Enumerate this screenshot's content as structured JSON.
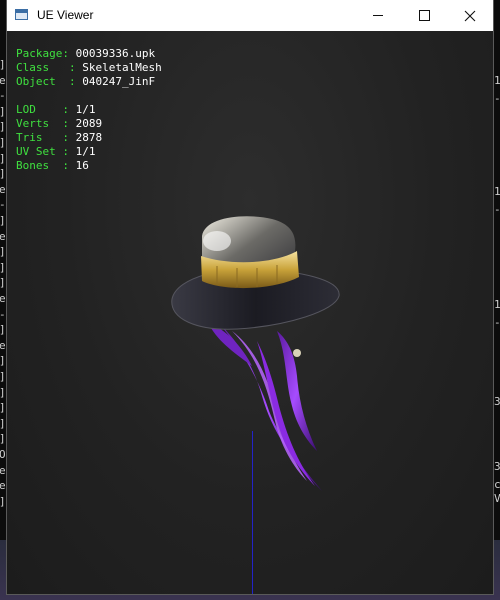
{
  "window": {
    "title": "UE Viewer",
    "controls": {
      "minimize": "minimize",
      "maximize": "maximize",
      "close": "close"
    }
  },
  "info": {
    "package": {
      "key": "Package: ",
      "value": "00039336.upk"
    },
    "class": {
      "key": "Class   : ",
      "value": "SkeletalMesh"
    },
    "object": {
      "key": "Object  : ",
      "value": "040247_JinF"
    },
    "lod": {
      "key": "LOD    : ",
      "value": "1/1"
    },
    "verts": {
      "key": "Verts  : ",
      "value": "2089"
    },
    "tris": {
      "key": "Tris   : ",
      "value": "2878"
    },
    "uvset": {
      "key": "UV Set : ",
      "value": "1/1"
    },
    "bones": {
      "key": "Bones  : ",
      "value": "16"
    }
  },
  "background_console": {
    "left_glyphs": [
      "]",
      "e",
      "-",
      "]",
      "]",
      "]",
      "]",
      "]",
      "e",
      "-",
      "]",
      "e",
      "]",
      "]",
      "]",
      "e",
      "-",
      "]",
      "e",
      "]",
      "]",
      "]",
      "]",
      "]",
      "]",
      "O",
      "e",
      "e",
      "]"
    ],
    "right_glyphs": [
      "1",
      "-",
      "1",
      "-",
      "1",
      "-",
      "3",
      "3",
      "c",
      "V"
    ]
  },
  "colors": {
    "label_green": "#3fe03f",
    "value_white": "#ffffff",
    "viewport_bg": "#232323",
    "axis_blue": "#2323c8",
    "hat_band_gold": "#c9a33a",
    "feather_purple": "#8a2be2"
  }
}
